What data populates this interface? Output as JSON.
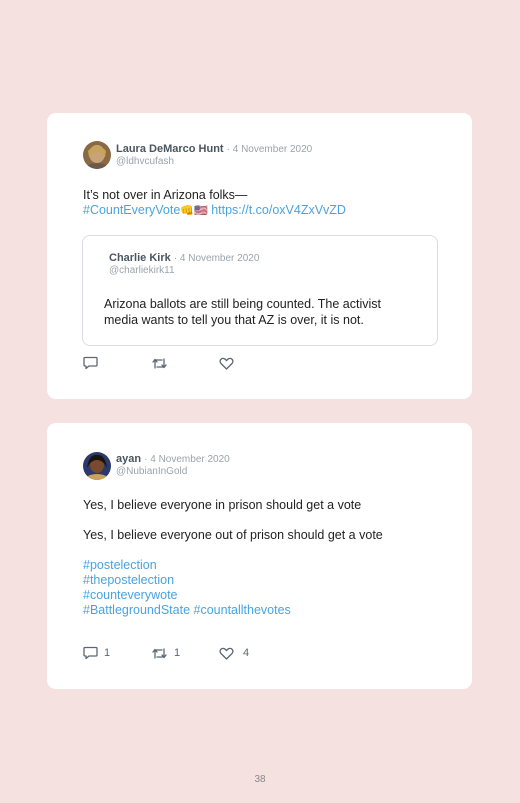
{
  "tweet1": {
    "author_name": "Laura DeMarco Hunt",
    "date": "4 November 2020",
    "handle": "@ldhvcufash",
    "text_line1": "It’s not over in Arizona folks—",
    "hashtag": "#CountEveryVote",
    "emoji_fist": "👊",
    "emoji_flag": "🇺🇸",
    "link": "https://t.co/oxV4ZxVvZD",
    "quoted": {
      "author_name": "Charlie Kirk",
      "date": "4 November 2020",
      "handle": "@charliekirk11",
      "text_line1": "Arizona ballots are still being counted. The activist",
      "text_line2": "media wants to tell you that AZ is over, it is not."
    },
    "actions": {
      "replies": "",
      "retweets": "",
      "likes": ""
    }
  },
  "tweet2": {
    "author_name": "ayan",
    "date": "4 November 2020",
    "handle": "@NubianInGold",
    "text_line1": "Yes, I believe everyone in prison should get a vote",
    "text_line2": "Yes, I believe everyone out of prison should get a vote",
    "hashtags": [
      "#postelection",
      "#thepostelection",
      "#counteverywote",
      "#BattlegroundState",
      "#countallthevotes"
    ],
    "actions": {
      "replies": "1",
      "retweets": "1",
      "likes": "4"
    }
  },
  "page_number": "38",
  "colors": {
    "background": "#f5e1e0",
    "card": "#ffffff",
    "link": "#4aa3df",
    "muted": "#9aa3ab"
  },
  "icons": [
    "reply-icon",
    "retweet-icon",
    "like-icon"
  ]
}
